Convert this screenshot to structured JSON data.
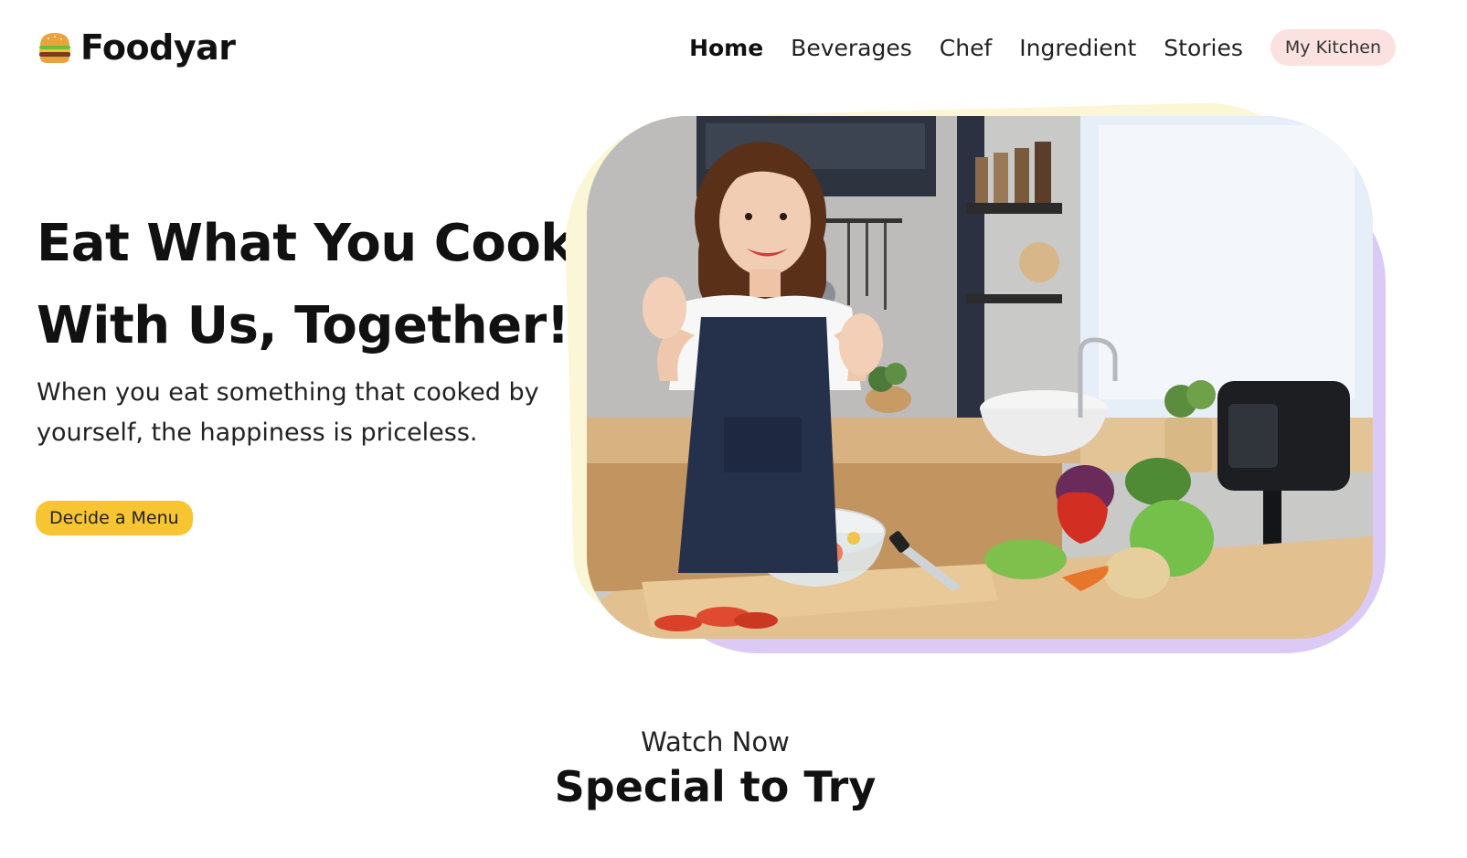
{
  "brand": {
    "name": "Foodyar",
    "icon": "burger-icon"
  },
  "nav": {
    "items": [
      {
        "label": "Home",
        "active": true
      },
      {
        "label": "Beverages",
        "active": false
      },
      {
        "label": "Chef",
        "active": false
      },
      {
        "label": "Ingredient",
        "active": false
      },
      {
        "label": "Stories",
        "active": false
      }
    ],
    "kitchen_button": "My Kitchen"
  },
  "hero": {
    "title_line1": "Eat What You Cook",
    "title_line2": "With Us, Together!",
    "subtitle": "When you eat something that cooked by yourself, the happiness is priceless.",
    "cta": "Decide a Menu"
  },
  "section": {
    "eyebrow": "Watch Now",
    "title": "Special to Try"
  },
  "colors": {
    "cta": "#f7c531",
    "kitchen_button": "#fbe1df",
    "blob_yellow": "#fbf6d6",
    "blob_purple": "#dccaf6"
  }
}
